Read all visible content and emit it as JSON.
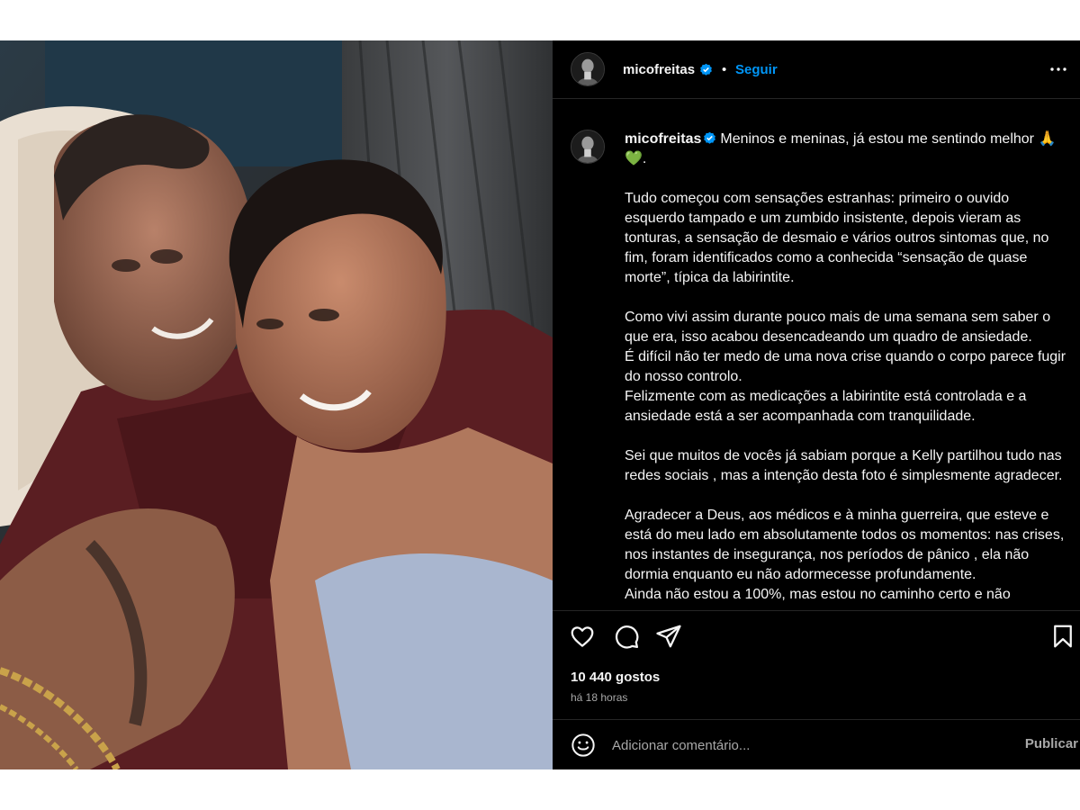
{
  "post": {
    "username": "micofreitas",
    "separator": "•",
    "follow_label": "Seguir",
    "caption": {
      "first_line": "Meninos e meninas, já estou me sentindo melhor 🙏",
      "first_line_end": "💚.",
      "paragraphs": [
        "Tudo começou com sensações estranhas: primeiro o ouvido esquerdo tampado e um zumbido insistente, depois vieram as tonturas, a sensação de desmaio e vários outros sintomas que, no fim, foram identificados como a conhecida “sensação de quase morte”, típica da labirintite.",
        "Como vivi assim durante pouco mais de uma semana sem saber o que era, isso acabou desencadeando um quadro de ansiedade.\nÉ difícil não ter medo de uma nova crise quando o corpo parece fugir do nosso controlo.\nFelizmente com as medicações a labirintite está controlada e a ansiedade está a ser acompanhada com tranquilidade.",
        "Sei que muitos de vocês já sabiam porque a Kelly partilhou tudo nas redes sociais , mas a intenção desta foto é simplesmente agradecer.",
        "Agradecer a Deus, aos médicos e à minha guerreira, que esteve e está do meu lado em absolutamente todos os momentos: nas crises, nos instantes de insegurança, nos períodos de pânico , ela não dormia enquanto eu não adormecesse profundamente.\nAinda não estou a 100%, mas estou no caminho certo e não"
      ]
    },
    "likes": "10 440 gostos",
    "time_ago": "há 18 horas",
    "comment_placeholder": "Adicionar comentário...",
    "publish_label": "Publicar"
  },
  "icons": {
    "verified": "verified-badge-icon",
    "more": "more-options-icon",
    "like": "heart-icon",
    "comment": "comment-bubble-icon",
    "share": "send-icon",
    "save": "bookmark-icon",
    "emoji": "emoji-smile-icon"
  },
  "colors": {
    "panel_background": "#000000",
    "text": "#f5f5f5",
    "secondary_text": "#a8a8a8",
    "link_blue": "#0095f6",
    "verified_blue": "#0095f6",
    "divider": "#262626"
  }
}
